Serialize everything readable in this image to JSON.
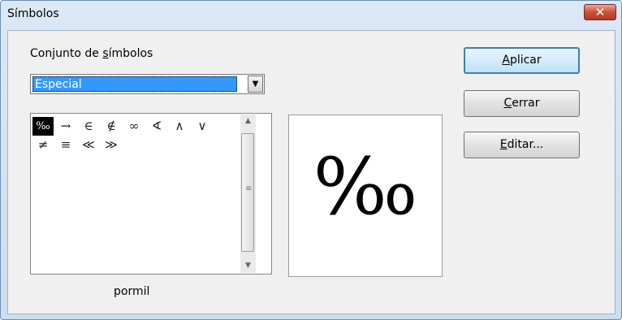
{
  "window": {
    "title": "Símbolos"
  },
  "set_label": {
    "before": "Conjunto de ",
    "mnemonic": "s",
    "after": "ímbolos"
  },
  "combo": {
    "selected": "Especial"
  },
  "symbols": [
    "‰",
    "→",
    "∈",
    "∉",
    "∞",
    "∢",
    "∧",
    "∨",
    "≠",
    "≡",
    "≪",
    "≫"
  ],
  "selected_symbol_name": "pormil",
  "preview_symbol": "‰",
  "buttons": {
    "apply": {
      "mnemonic": "A",
      "rest": "plicar"
    },
    "close": {
      "mnemonic": "C",
      "rest": "errar"
    },
    "edit": {
      "mnemonic": "E",
      "rest": "ditar..."
    }
  },
  "colors": {
    "selection": "#3399ff",
    "close_button": "#c9503b"
  }
}
